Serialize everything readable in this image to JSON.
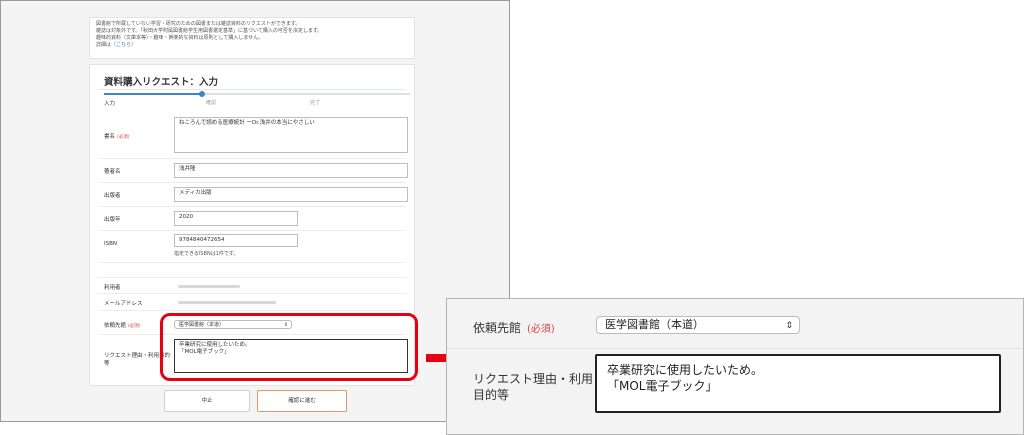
{
  "notice": {
    "lines": [
      "図書館で所蔵していない学習・研究のための図書または雑誌資料のリクエストができます。",
      "雑誌は対象外です。「秋田大学附属図書館学生用図書選定基準」に基づいて購入の可否を決定します。",
      "趣味的資料（文庫本等）・趣味・娯楽的な資料は原則として購入しません。"
    ],
    "detail_prefix": "詳細は",
    "detail_link": "（こちら）"
  },
  "form": {
    "title": "資料購入リクエスト：入力",
    "steps": [
      "入力",
      "確認",
      "完了"
    ],
    "required_mark": "(必須)",
    "fields": {
      "book_title": {
        "label": "書名",
        "value": "ねころんで読める医療統計 ーDr.浅井の本当にやさしい"
      },
      "author": {
        "label": "著者名",
        "value": "浅井隆"
      },
      "publisher": {
        "label": "出版者",
        "value": "メディカ出版"
      },
      "year": {
        "label": "出版年",
        "value": "2020"
      },
      "isbn": {
        "label": "ISBN",
        "value": "9784840472654",
        "hint": "指定できるISBNは1件です。"
      },
      "user": {
        "label": "利用者"
      },
      "email": {
        "label": "メールアドレス"
      },
      "library": {
        "label": "依頼先館",
        "value": "医学図書館（本道）"
      },
      "reason": {
        "label": "リクエスト理由・利用目的等",
        "value": "卒業研究に使用したいため。\n「MOL電子ブック」"
      }
    },
    "buttons": {
      "cancel": "中止",
      "confirm": "確認に進む"
    }
  },
  "zoom": {
    "library_label": "依頼先館",
    "required_mark": "(必須)",
    "library_value": "医学図書館（本道）",
    "reason_label_line1": "リクエスト理由・利用",
    "reason_label_line2": "目的等",
    "reason_value": "卒業研究に使用したいため。\n「MOL電子ブック」"
  },
  "colors": {
    "accent": "#3f86c9",
    "highlight": "#e60012",
    "required": "#d04545",
    "confirm_border": "#e2986a"
  },
  "icons": {
    "select_chevron": "chevron-updown-icon",
    "arrow": "arrow-right-icon"
  }
}
